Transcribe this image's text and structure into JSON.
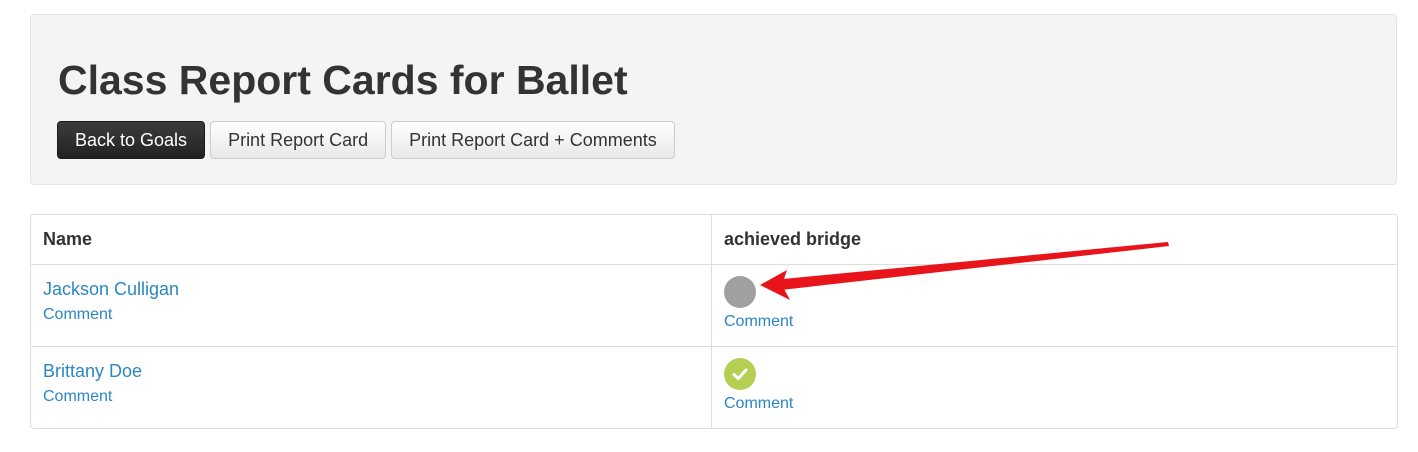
{
  "header": {
    "title": "Class Report Cards for Ballet",
    "buttons": {
      "back": "Back to Goals",
      "print": "Print Report Card",
      "print_comments": "Print Report Card + Comments"
    }
  },
  "table": {
    "columns": [
      "Name",
      "achieved bridge"
    ],
    "rows": [
      {
        "name": "Jackson Culligan",
        "name_comment": "Comment",
        "status": "not-achieved",
        "status_icon": "gray-circle-icon",
        "status_comment": "Comment"
      },
      {
        "name": "Brittany Doe",
        "name_comment": "Comment",
        "status": "achieved",
        "status_icon": "green-check-circle-icon",
        "status_comment": "Comment"
      }
    ]
  },
  "colors": {
    "accent_link": "#2a87c4",
    "status_gray": "#a0a0a0",
    "status_green": "#b5cf54",
    "annotation_arrow": "#e8141b"
  }
}
